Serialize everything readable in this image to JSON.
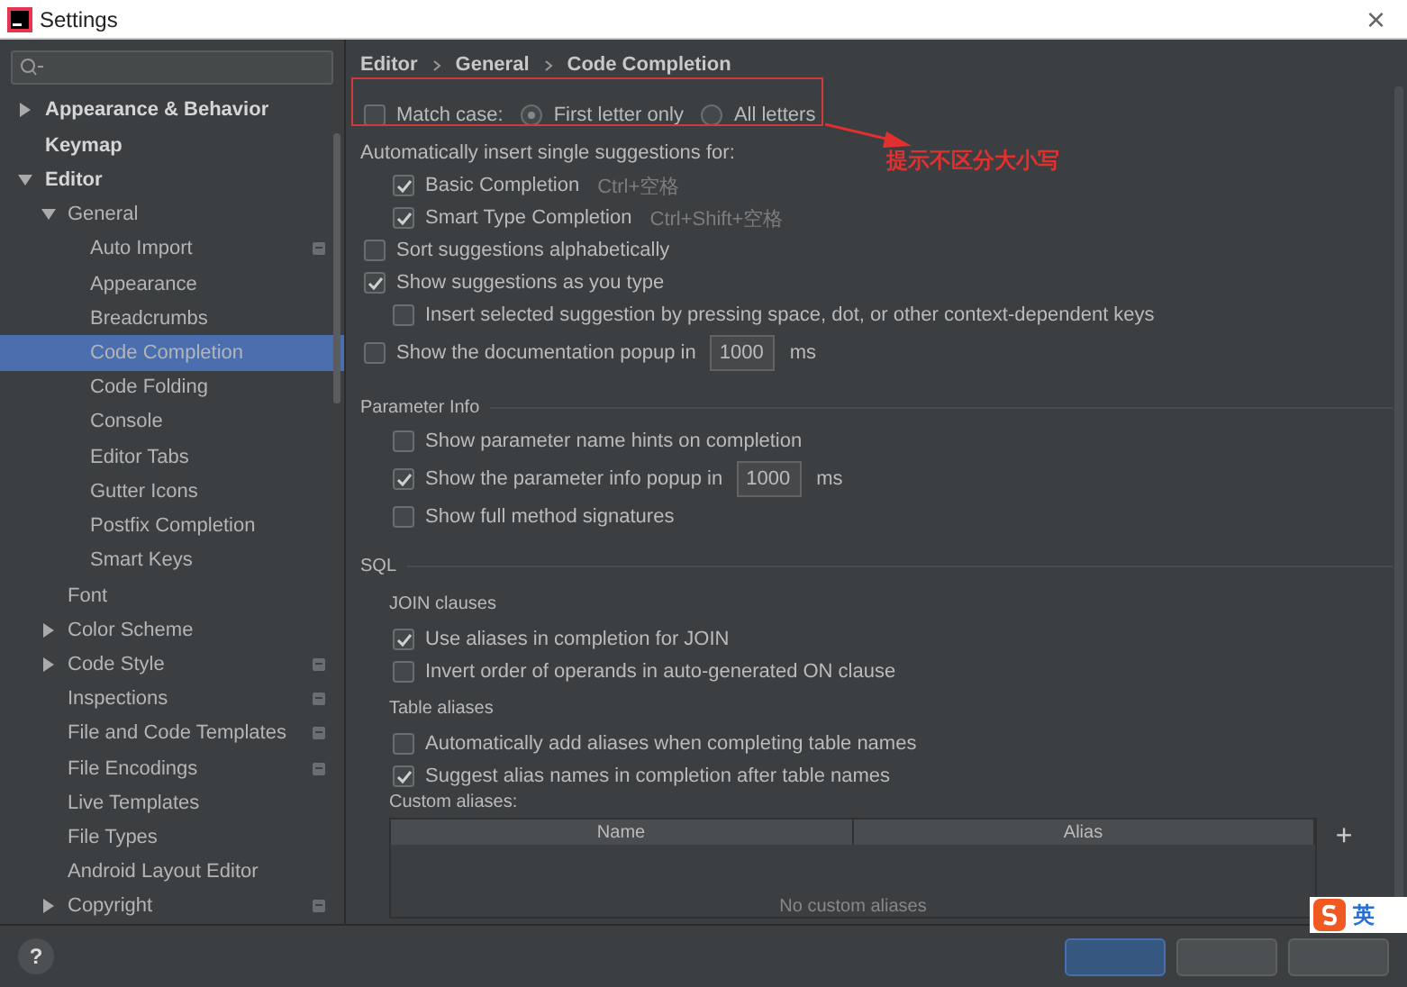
{
  "window": {
    "title": "Settings",
    "close": "×"
  },
  "sidebar": {
    "items": [
      {
        "label": "Appearance & Behavior",
        "expanded": false,
        "selected": false
      },
      {
        "label": "Keymap",
        "selected": false
      },
      {
        "label": "Editor",
        "expanded": true,
        "selected": false,
        "children": [
          {
            "label": "General",
            "expanded": true,
            "selected": false,
            "children": [
              {
                "label": "Auto Import",
                "selected": false,
                "scope_icon": true
              },
              {
                "label": "Appearance",
                "selected": false
              },
              {
                "label": "Breadcrumbs",
                "selected": false
              },
              {
                "label": "Code Completion",
                "selected": true
              },
              {
                "label": "Code Folding",
                "selected": false
              },
              {
                "label": "Console",
                "selected": false
              },
              {
                "label": "Editor Tabs",
                "selected": false
              },
              {
                "label": "Gutter Icons",
                "selected": false
              },
              {
                "label": "Postfix Completion",
                "selected": false
              },
              {
                "label": "Smart Keys",
                "selected": false
              }
            ]
          },
          {
            "label": "Font",
            "selected": false
          },
          {
            "label": "Color Scheme",
            "expanded": false,
            "selected": false
          },
          {
            "label": "Code Style",
            "expanded": false,
            "selected": false,
            "scope_icon": true
          },
          {
            "label": "Inspections",
            "selected": false,
            "scope_icon": true
          },
          {
            "label": "File and Code Templates",
            "selected": false,
            "scope_icon": true
          },
          {
            "label": "File Encodings",
            "selected": false,
            "scope_icon": true
          },
          {
            "label": "Live Templates",
            "selected": false
          },
          {
            "label": "File Types",
            "selected": false
          },
          {
            "label": "Android Layout Editor",
            "selected": false
          },
          {
            "label": "Copyright",
            "expanded": false,
            "selected": false,
            "scope_icon": true
          }
        ]
      }
    ]
  },
  "breadcrumb": [
    "Editor",
    "General",
    "Code Completion"
  ],
  "settings": [
    {
      "kind": "match_case",
      "label": "Match case:",
      "checked": false,
      "options": [
        {
          "label": "First letter only",
          "selected": true
        },
        {
          "label": "All letters",
          "selected": false
        }
      ]
    },
    {
      "kind": "label",
      "text": "Automatically insert single suggestions for:",
      "children": [
        {
          "kind": "checkbox",
          "label": "Basic Completion",
          "shortcut": "Ctrl+空格",
          "checked": true
        },
        {
          "kind": "checkbox",
          "label": "Smart Type Completion",
          "shortcut": "Ctrl+Shift+空格",
          "checked": true
        }
      ]
    },
    {
      "kind": "checkbox",
      "label": "Sort suggestions alphabetically",
      "checked": false
    },
    {
      "kind": "checkbox",
      "label": "Show suggestions as you type",
      "checked": true,
      "children": [
        {
          "kind": "checkbox",
          "label": "Insert selected suggestion by pressing space, dot, or other context-dependent keys",
          "checked": false
        }
      ]
    },
    {
      "kind": "checkbox",
      "label": "Show the documentation popup in",
      "value": "1000",
      "unit": "ms",
      "checked": false
    },
    {
      "kind": "section",
      "title": "Parameter Info",
      "children": [
        {
          "kind": "checkbox",
          "label": "Show parameter name hints on completion",
          "checked": false
        },
        {
          "kind": "checkbox",
          "label": "Show the parameter info popup in",
          "value": "1000",
          "unit": "ms",
          "checked": true
        },
        {
          "kind": "checkbox",
          "label": "Show full method signatures",
          "checked": false
        }
      ]
    },
    {
      "kind": "section",
      "title": "SQL",
      "children": [
        {
          "kind": "subheading",
          "text": "JOIN clauses",
          "children": [
            {
              "kind": "checkbox",
              "label": "Use aliases in completion for JOIN",
              "checked": true
            },
            {
              "kind": "checkbox",
              "label": "Invert order of operands in auto-generated ON clause",
              "checked": false
            }
          ]
        },
        {
          "kind": "subheading",
          "text": "Table aliases",
          "children": [
            {
              "kind": "checkbox",
              "label": "Automatically add aliases when completing table names",
              "checked": false
            },
            {
              "kind": "checkbox",
              "label": "Suggest alias names in completion after table names",
              "checked": true
            },
            {
              "kind": "table",
              "label": "Custom aliases:",
              "columns": [
                "Name",
                "Alias"
              ],
              "empty_text": "No custom aliases",
              "add": "+"
            }
          ]
        }
      ]
    }
  ],
  "annotation": {
    "text": "提示不区分大小写"
  },
  "footer": {
    "help": "?",
    "buttons": [
      {
        "primary": true
      },
      {
        "primary": false
      },
      {
        "primary": false
      }
    ]
  },
  "ime": {
    "label": "英"
  }
}
